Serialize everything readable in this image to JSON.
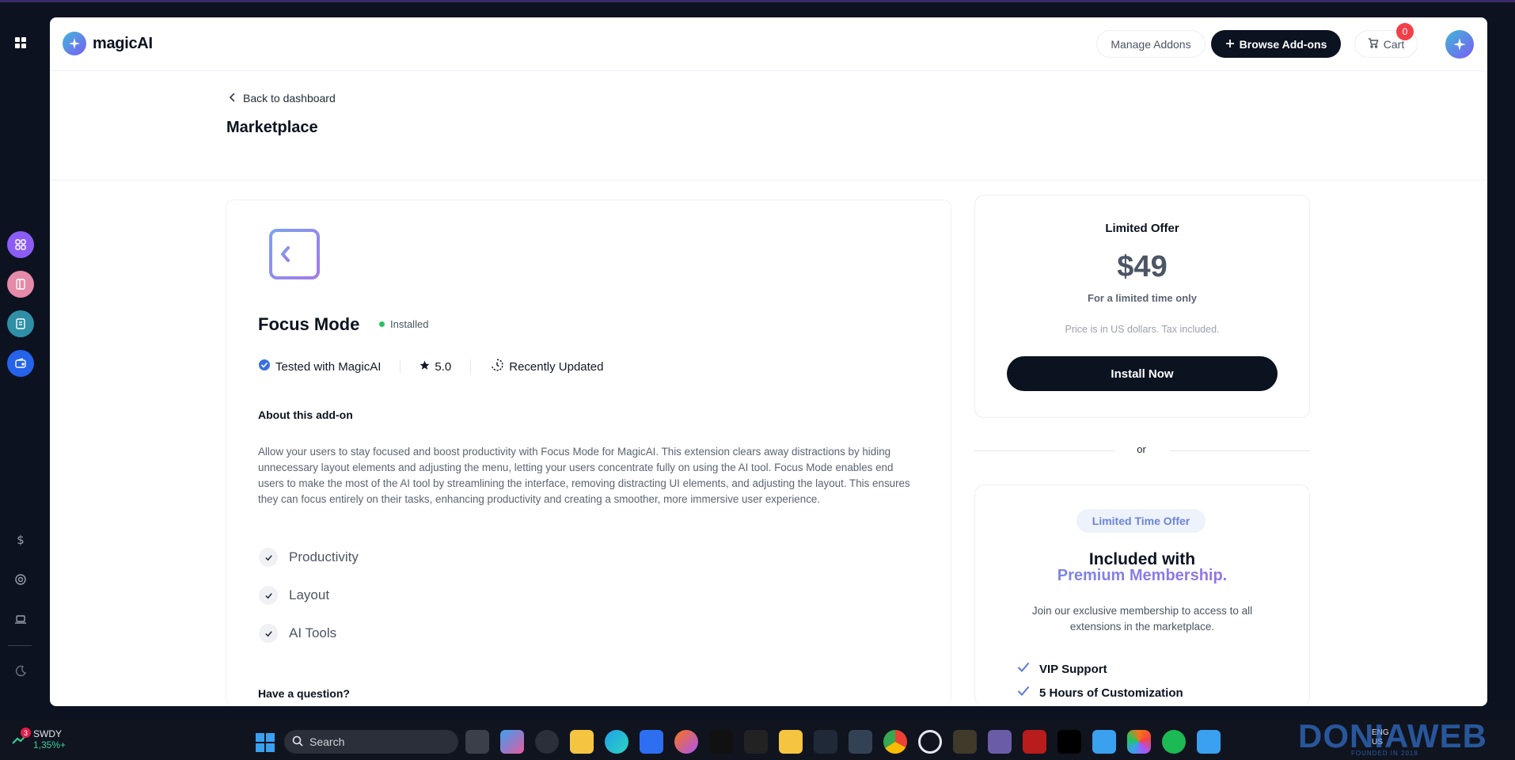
{
  "brand": {
    "name": "magicAI"
  },
  "header": {
    "manage_label": "Manage Addons",
    "browse_label": "Browse Add-ons",
    "cart_label": "Cart",
    "cart_count": "0"
  },
  "nav": {
    "back_label": "Back to dashboard",
    "page_title": "Marketplace"
  },
  "addon": {
    "name": "Focus Mode",
    "status": "Installed",
    "tested": "Tested with MagicAI",
    "rating": "5.0",
    "updated": "Recently Updated",
    "about_heading": "About this add-on",
    "description": "Allow your users to stay focused and boost productivity with Focus Mode for MagicAI. This extension clears away distractions by hiding unnecessary layout elements and adjusting the menu, letting your users concentrate fully on using the AI tool. Focus Mode enables end users to make the most of the AI tool by streamlining the interface, removing distracting UI elements, and adjusting the layout. This ensures they can focus entirely on their tasks, enhancing productivity and creating a smoother, more immersive user experience.",
    "features": [
      "Productivity",
      "Layout",
      "AI Tools"
    ],
    "question_heading": "Have a question?"
  },
  "offer": {
    "title": "Limited Offer",
    "price": "$49",
    "subtitle": "For a limited time only",
    "tax_note": "Price is in US dollars. Tax included.",
    "install_label": "Install Now"
  },
  "divider": {
    "or_label": "or"
  },
  "membership": {
    "badge": "Limited Time Offer",
    "heading": "Included with",
    "highlight": "Premium Membership.",
    "description": "Join our exclusive membership to access to all extensions in the marketplace.",
    "perks": [
      "VIP Support",
      "5 Hours of Customization"
    ]
  },
  "taskbar": {
    "stock_name": "SWDY",
    "stock_value": "1,35%+",
    "stock_badge": "3",
    "search_placeholder": "Search",
    "lang": "ENG",
    "lang_region": "US"
  },
  "watermark": {
    "text": "DONIAWEB",
    "sub": "FOUNDED IN 2018"
  },
  "colors": {
    "primary_dark": "#0b1220",
    "accent_gradient_start": "#3fb7d8",
    "accent_gradient_end": "#7a5cf5",
    "status_green": "#22c55e",
    "badge_red": "#f2404a"
  }
}
